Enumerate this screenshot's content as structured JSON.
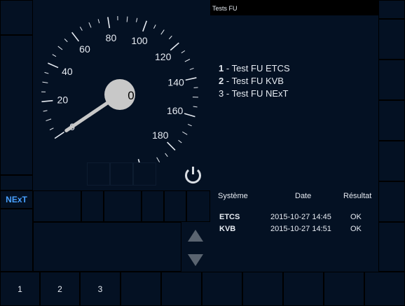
{
  "screen_title": "Tests FU",
  "left_panel": {
    "next_label": "NExT"
  },
  "speedometer": {
    "speed_value": "0",
    "scale_labels": [
      "0",
      "20",
      "40",
      "60",
      "80",
      "100",
      "120",
      "140",
      "160",
      "180"
    ],
    "max_speed": 200,
    "needle_speed": 0
  },
  "menu": [
    {
      "num": "1",
      "sep": " - ",
      "label": "Test FU ETCS"
    },
    {
      "num": "2",
      "sep": " - ",
      "label": "Test FU KVB"
    },
    {
      "num": "3",
      "sep": " - ",
      "label": "Test FU NExT"
    }
  ],
  "results_table": {
    "headers": {
      "system": "Système",
      "date": "Date",
      "result": "Résultat"
    },
    "rows": [
      {
        "system": "ETCS",
        "date": "2015-10-27 14:45",
        "result": "OK"
      },
      {
        "system": "KVB",
        "date": "2015-10-27 14:51",
        "result": "OK"
      }
    ]
  },
  "bottom_keys": [
    "1",
    "2",
    "3"
  ],
  "icons": {
    "power": "power-icon",
    "up": "arrow-up-icon",
    "down": "arrow-down-icon"
  },
  "colors": {
    "background": "#041123",
    "accent": "#48a0ff",
    "text": "#e6ebf2",
    "button": "#5a6470"
  }
}
